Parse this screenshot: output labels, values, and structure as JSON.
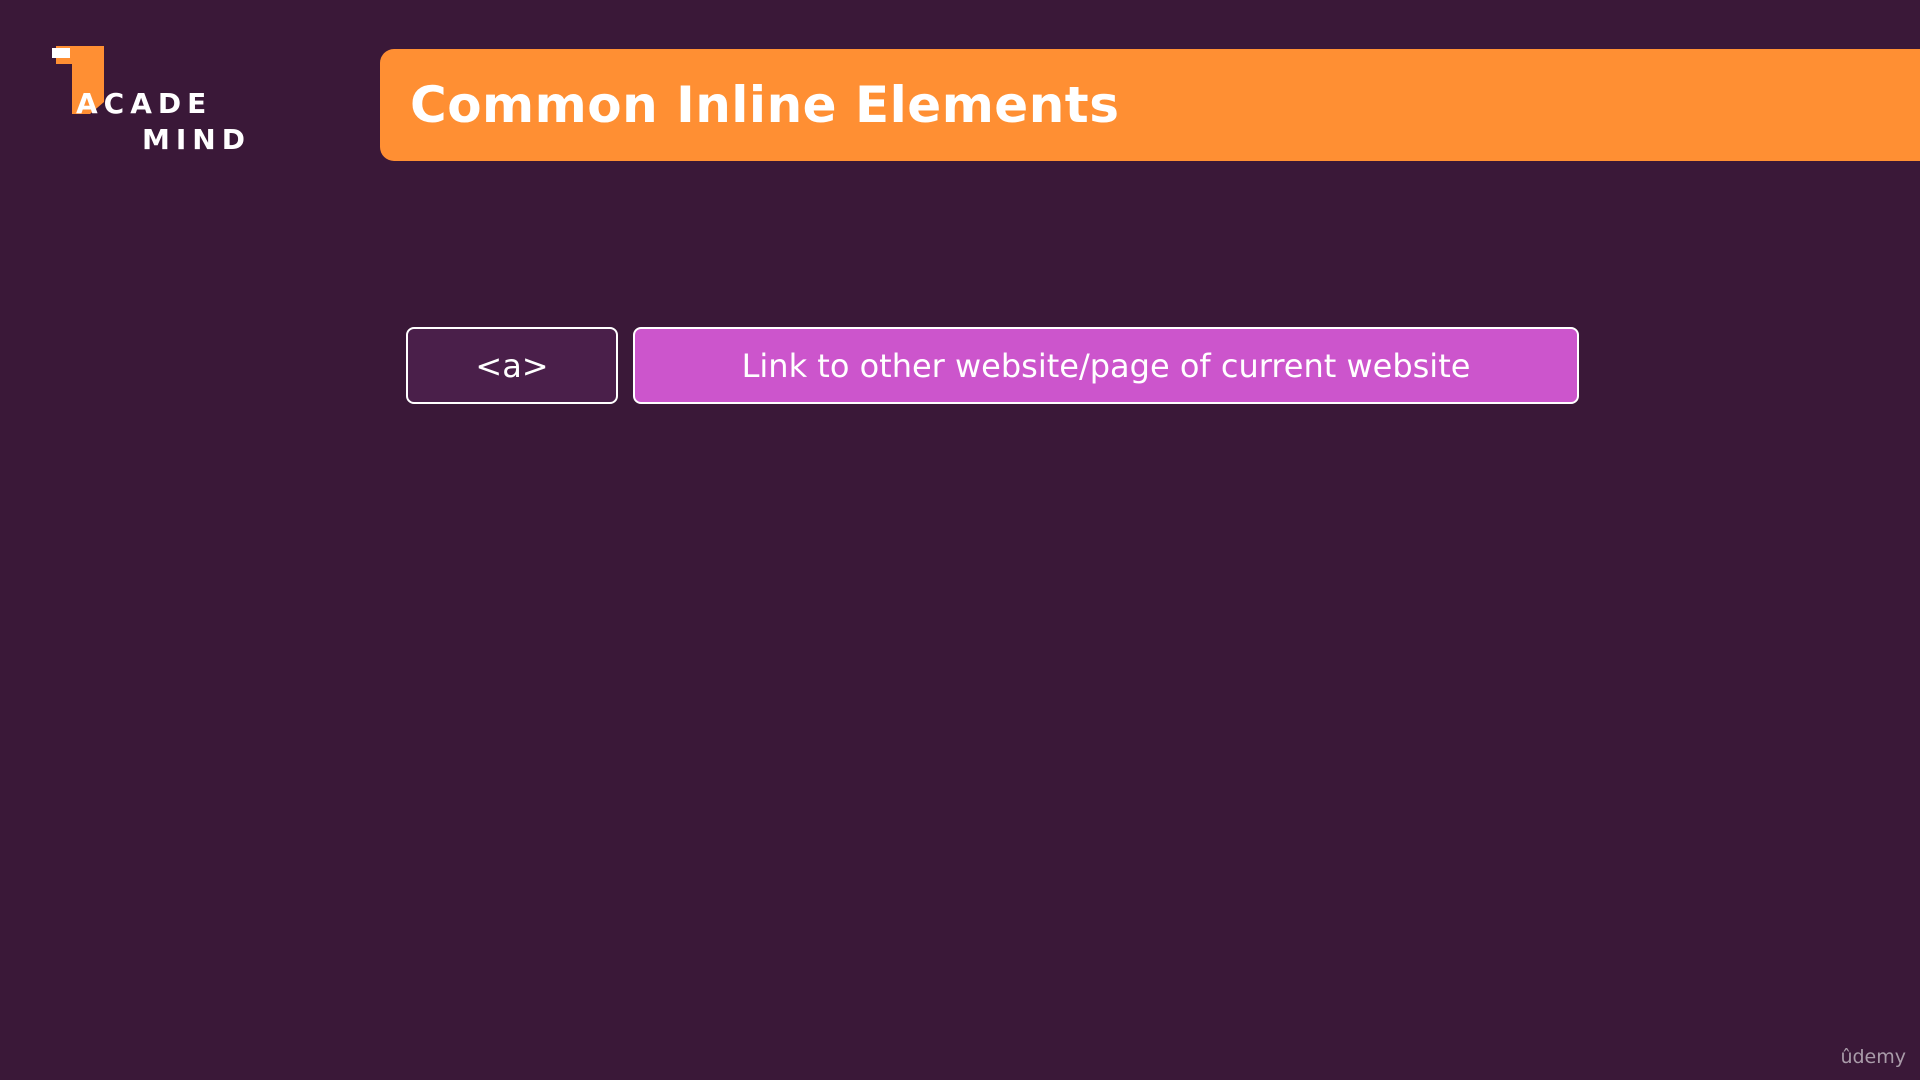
{
  "logo": {
    "line1": "ACADE",
    "line2": "MIND"
  },
  "title": "Common Inline Elements",
  "element": {
    "tag": "<a>",
    "description": "Link to other website/page of current website"
  },
  "watermark": "ûdemy",
  "colors": {
    "background": "#3a1838",
    "title_banner": "#ff8f33",
    "tag_box": "#4a1f4a",
    "description_box": "#cc55cc",
    "text": "#ffffff"
  }
}
